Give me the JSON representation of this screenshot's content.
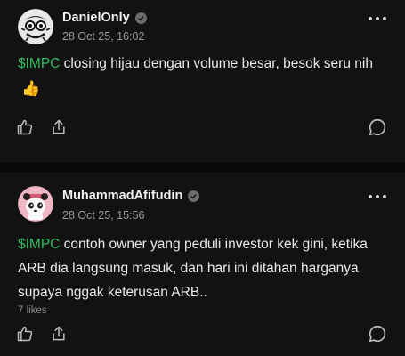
{
  "posts": [
    {
      "username": "DanielOnly",
      "timestamp": "28 Oct 25, 16:02",
      "ticker": "$IMPC",
      "text": " closing hijau dengan volume besar, besok seru nih",
      "emoji": "👍",
      "likes": ""
    },
    {
      "username": "MuhammadAfifudin",
      "timestamp": "28 Oct 25, 15:56",
      "ticker": "$IMPC",
      "text": " contoh owner yang peduli investor kek gini, ketika ARB dia langsung masuk, dan hari ini ditahan harganya supaya nggak keterusan ARB..",
      "emoji": "",
      "likes": "7 likes"
    }
  ],
  "colors": {
    "background": "#121212",
    "ticker": "#2fbf5f",
    "muted": "#9a9a9a"
  },
  "icons": [
    "more-icon",
    "verified-icon",
    "like-icon",
    "share-icon",
    "comment-icon"
  ]
}
